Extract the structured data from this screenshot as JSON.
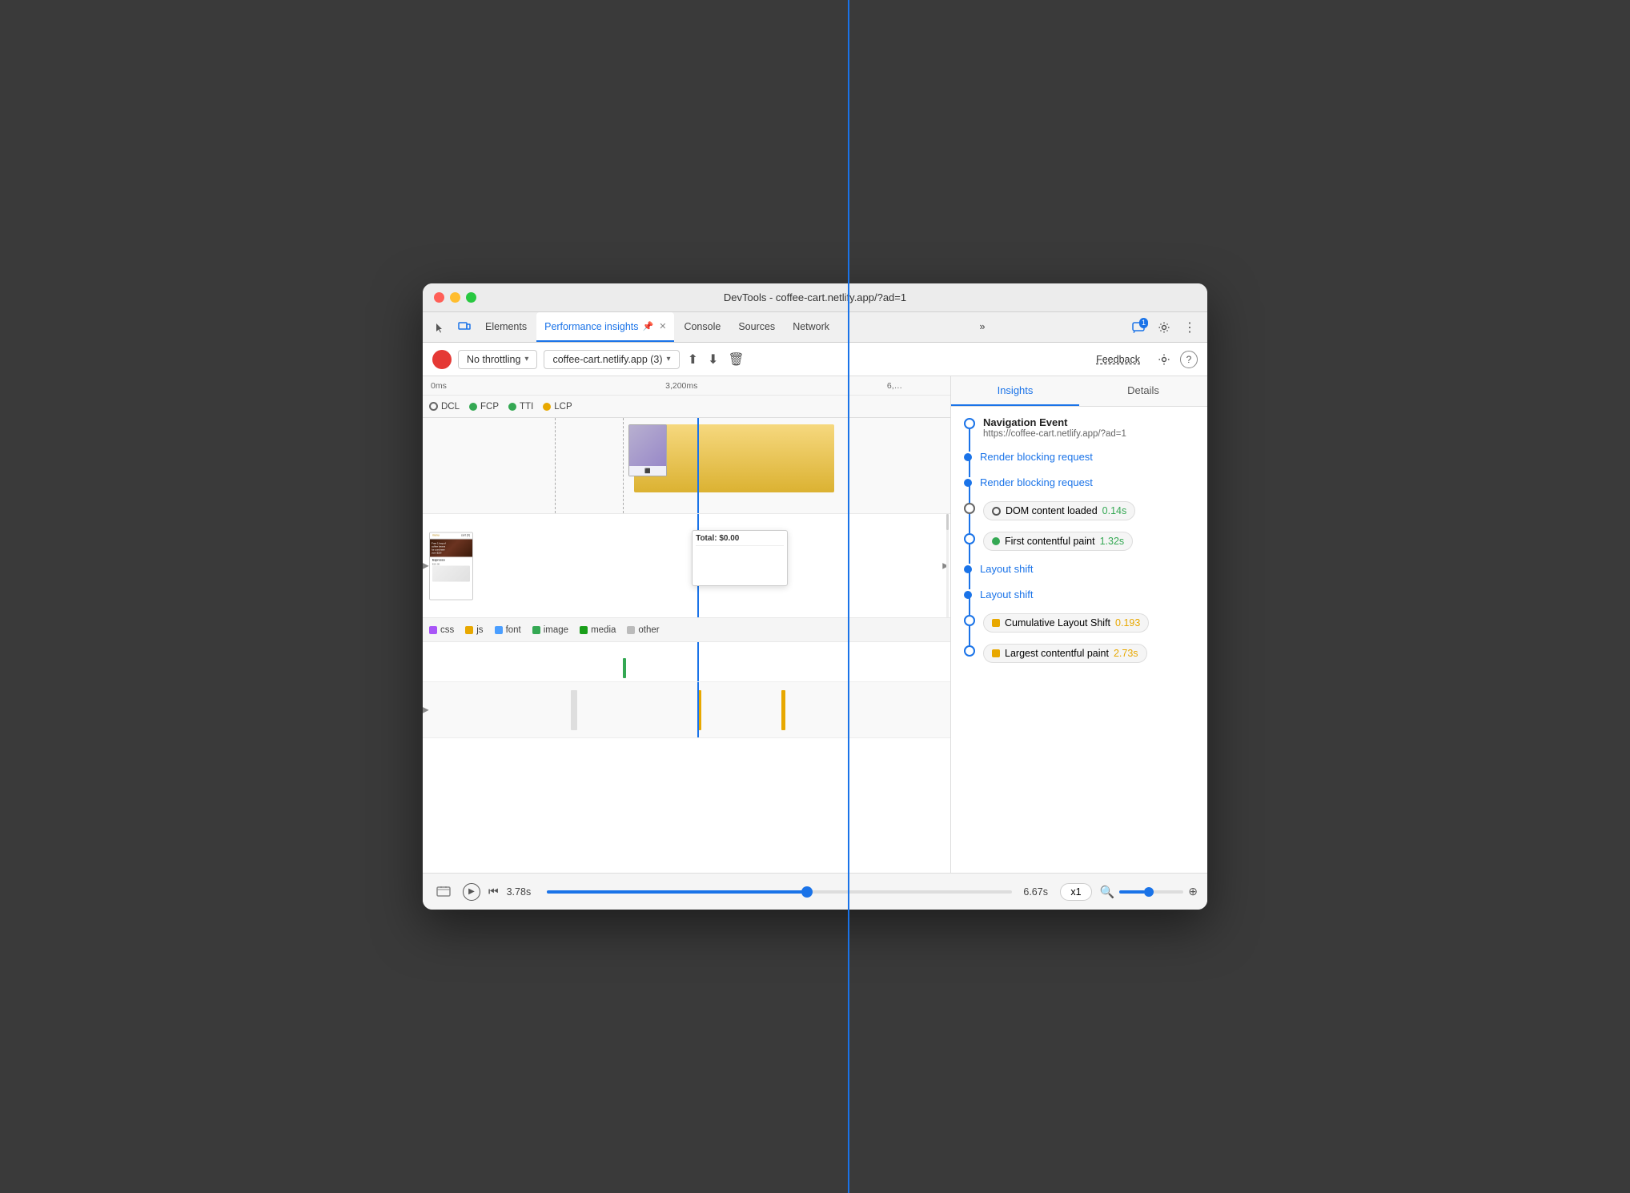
{
  "window": {
    "title": "DevTools - coffee-cart.netlify.app/?ad=1",
    "tabs": [
      {
        "id": "elements",
        "label": "Elements",
        "active": false
      },
      {
        "id": "performance-insights",
        "label": "Performance insights",
        "active": true,
        "closable": true
      },
      {
        "id": "console",
        "label": "Console",
        "active": false
      },
      {
        "id": "sources",
        "label": "Sources",
        "active": false
      },
      {
        "id": "network",
        "label": "Network",
        "active": false
      }
    ]
  },
  "toolbar": {
    "throttling": "No throttling",
    "url": "coffee-cart.netlify.app (3)",
    "feedback_label": "Feedback"
  },
  "timeline": {
    "markers": [
      {
        "label": "0ms",
        "left": "0%"
      },
      {
        "label": "3,200ms",
        "left": "52%"
      },
      {
        "label": "6,…",
        "left": "95%"
      }
    ],
    "legend": {
      "dcl": "DCL",
      "fcp": "FCP",
      "tti": "TTI",
      "lcp": "LCP",
      "types": [
        "css",
        "js",
        "font",
        "image",
        "media",
        "other"
      ]
    }
  },
  "insights_panel": {
    "tabs": [
      "Insights",
      "Details"
    ],
    "active_tab": "Insights",
    "entries": [
      {
        "type": "navigation",
        "title": "Navigation Event",
        "subtitle": "https://coffee-cart.netlify.app/?ad=1"
      },
      {
        "type": "link",
        "label": "Render blocking request"
      },
      {
        "type": "link",
        "label": "Render blocking request"
      },
      {
        "type": "chip",
        "chip_type": "circle",
        "label": "DOM content loaded",
        "value": "0.14s",
        "value_class": "value-normal"
      },
      {
        "type": "chip",
        "chip_type": "green-dot",
        "label": "First contentful paint",
        "value": "1.32s",
        "value_class": "value-green"
      },
      {
        "type": "link",
        "label": "Layout shift"
      },
      {
        "type": "link",
        "label": "Layout shift"
      },
      {
        "type": "chip",
        "chip_type": "square-orange",
        "label": "Cumulative Layout Shift",
        "value": "0.193",
        "value_class": "value-orange"
      },
      {
        "type": "chip",
        "chip_type": "square-orange",
        "label": "Largest contentful paint",
        "value": "2.73s",
        "value_class": "value-orange"
      }
    ]
  },
  "bottom_bar": {
    "time_current": "3.78s",
    "time_total": "6.67s",
    "speed": "x1"
  }
}
